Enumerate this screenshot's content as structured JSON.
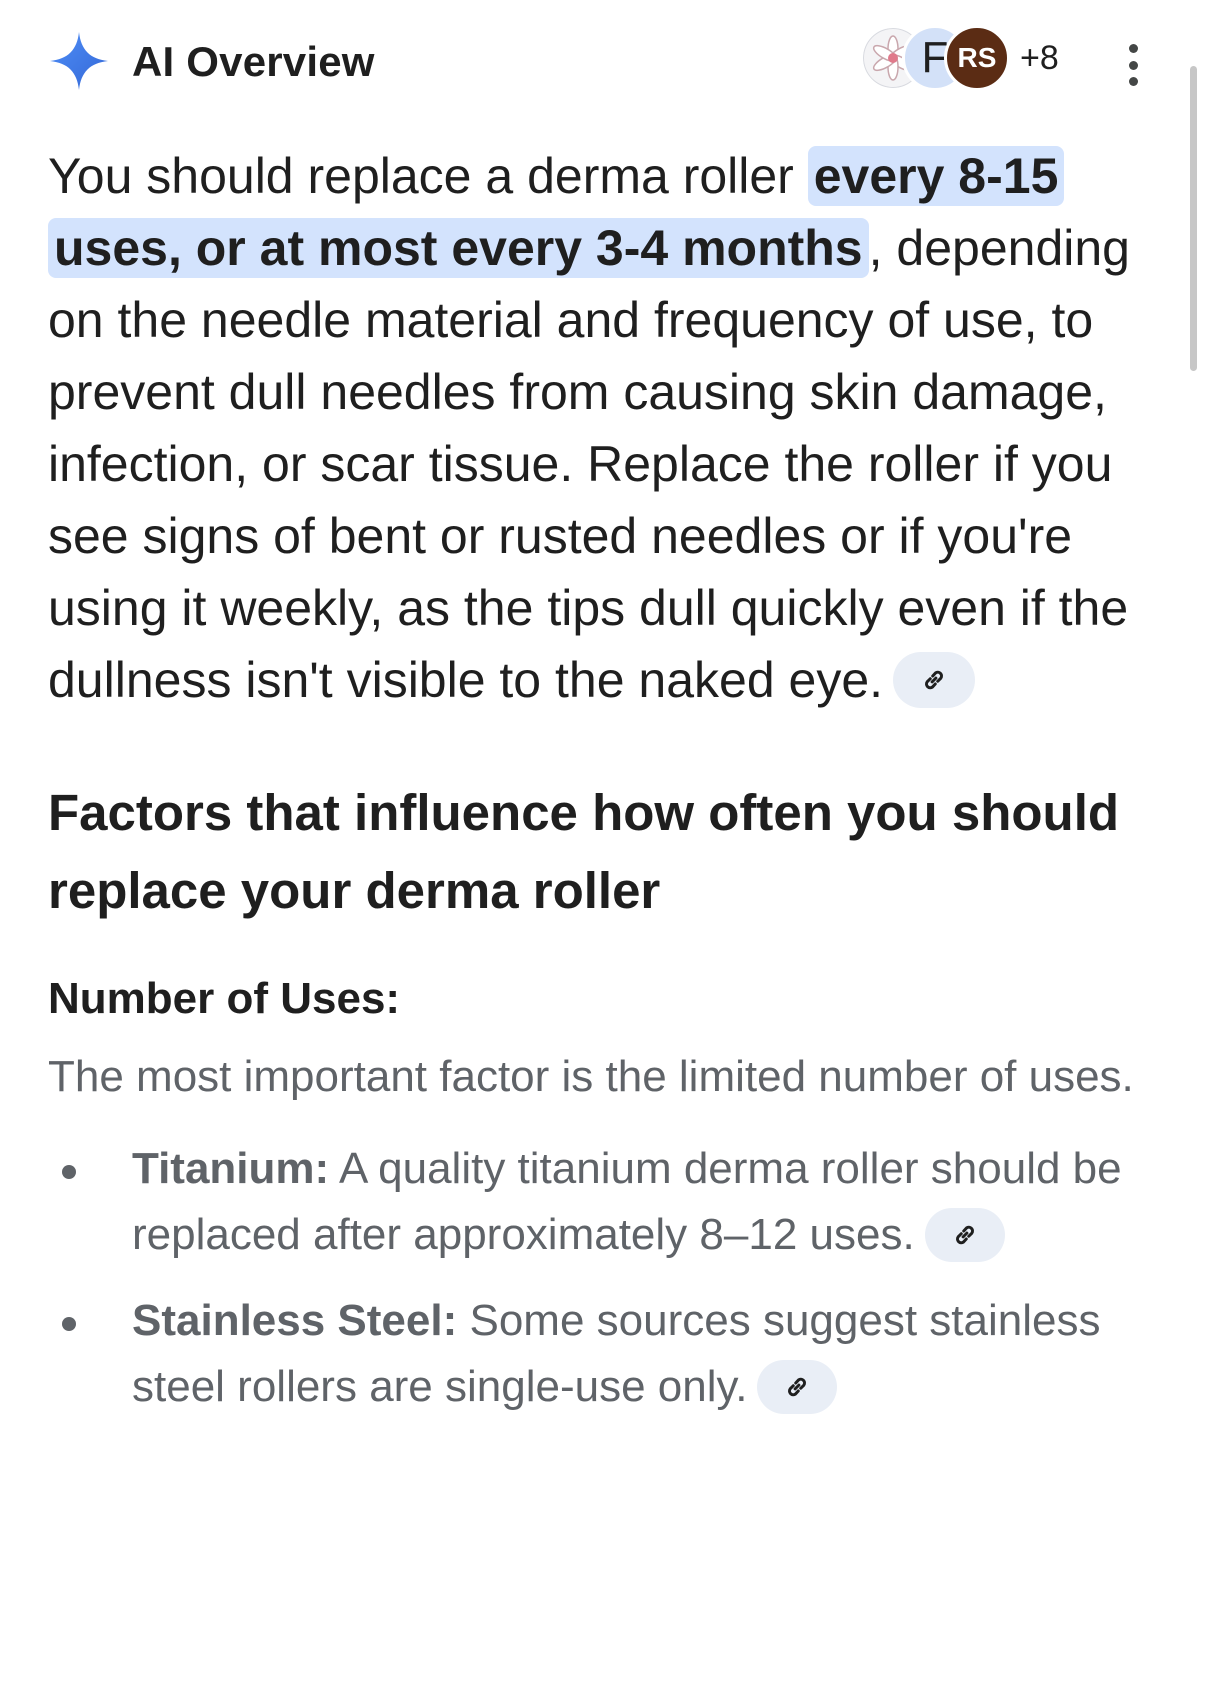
{
  "header": {
    "title": "AI Overview",
    "spark_icon": "sparkle-icon",
    "accent_color": "#4285f4",
    "avatars": [
      {
        "type": "image",
        "icon": "flower-icon"
      },
      {
        "type": "letter",
        "text": "F"
      },
      {
        "type": "letter",
        "text": "RS"
      }
    ],
    "more_count": "+8",
    "menu_icon": "more-vert-icon"
  },
  "answer": {
    "pre": "You should replace a derma roller ",
    "highlight": "every 8-15 uses, or at most every 3-4 months",
    "post": ", depending on the needle material and frequency of use, to prevent dull needles from causing skin damage, infection, or scar tissue. Replace the roller if you see signs of bent or rusted needles or if you're using it weekly, as the tips dull quickly even if the dullness isn't visible to the naked eye.",
    "highlight_color": "#d3e3fd"
  },
  "section": {
    "heading": "Factors that influence how often you should replace your derma roller",
    "subheading": "Number of Uses:",
    "paragraph": "The most important factor is the limited number of uses.",
    "bullets": [
      {
        "label": "Titanium:",
        "text": " A quality titanium derma roller should be replaced after approximately 8–12 uses."
      },
      {
        "label": "Stainless Steel:",
        "text": " Some sources suggest stainless steel rollers are single-use only."
      }
    ]
  }
}
